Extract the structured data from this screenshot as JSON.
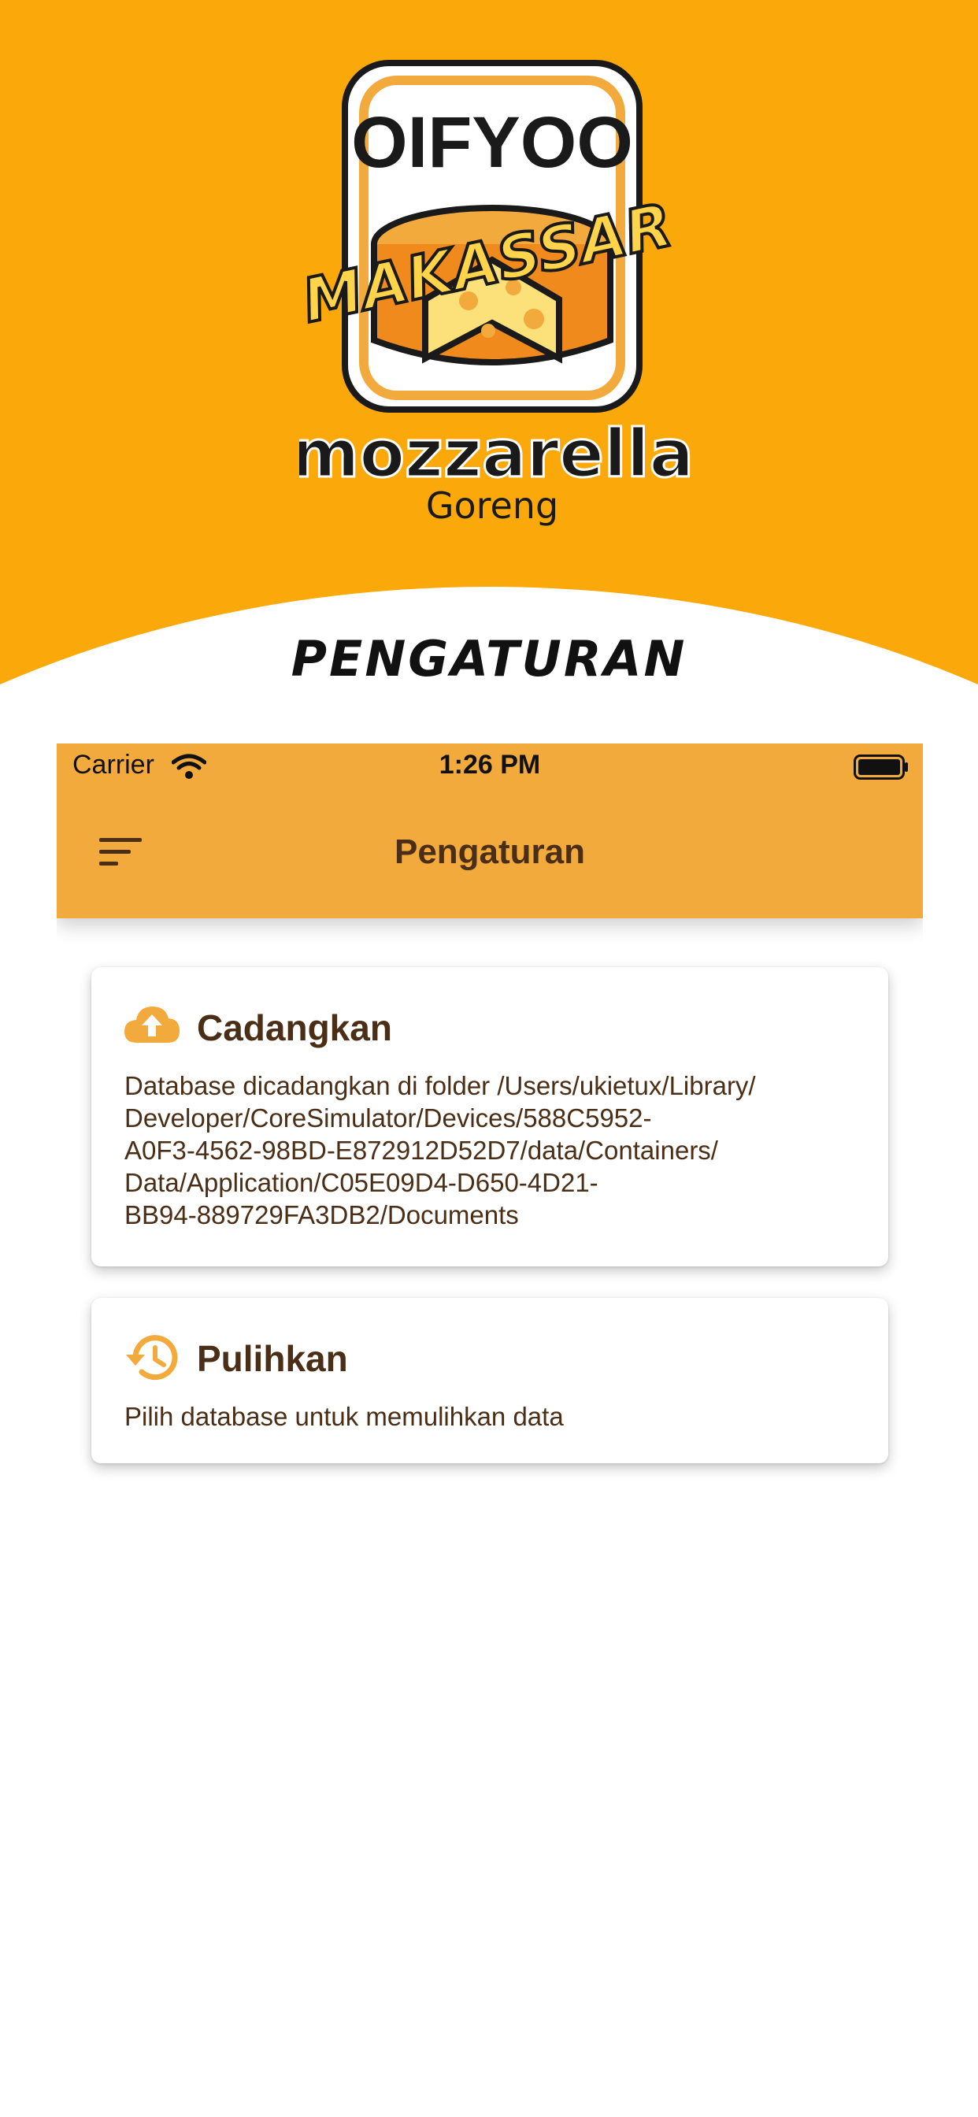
{
  "hero": {
    "logo_text": {
      "brand": "OIFYOO",
      "city": "Makassar",
      "product": "mozzarella",
      "sub": "Goreng"
    },
    "title": "PENGATURAN"
  },
  "status_bar": {
    "carrier": "Carrier",
    "time": "1:26 PM"
  },
  "appbar": {
    "title": "Pengaturan",
    "menu_icon": "sort-menu-icon"
  },
  "cards": {
    "backup": {
      "icon": "cloud-upload-icon",
      "title": "Cadangkan",
      "description": "Database dicadangkan di folder  /Users/ukietux/Library/\nDeveloper/CoreSimulator/Devices/588C5952-\nA0F3-4562-98BD-E872912D52D7/data/Containers/\nData/Application/C05E09D4-D650-4D21-\nBB94-889729FA3DB2/Documents"
    },
    "restore": {
      "icon": "history-icon",
      "title": "Pulihkan",
      "description": "Pilih database untuk memulihkan data"
    }
  },
  "colors": {
    "hero_bg": "#FBA90A",
    "appbar_bg": "#F3AA3C",
    "text_brown": "#4A2E15",
    "icon_accent": "#F3AA3C"
  }
}
